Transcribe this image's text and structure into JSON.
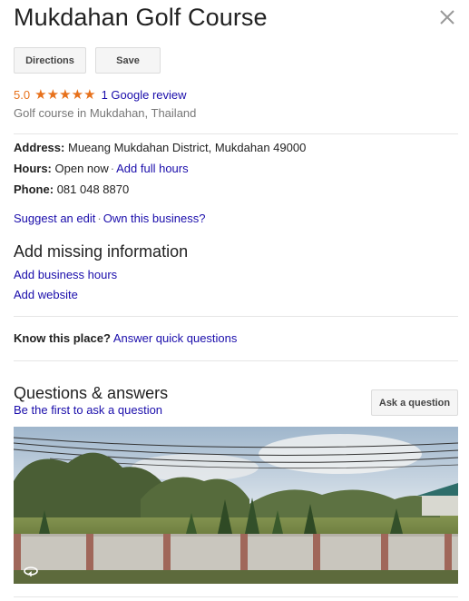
{
  "place": {
    "title": "Mukdahan Golf Course",
    "rating": "5.0",
    "stars": 5,
    "review_link": "1 Google review",
    "category": "Golf course in Mukdahan, Thailand"
  },
  "actions": {
    "directions": "Directions",
    "save": "Save"
  },
  "details": {
    "address_label": "Address:",
    "address_value": "Mueang Mukdahan District, Mukdahan 49000",
    "hours_label": "Hours:",
    "hours_value": "Open now",
    "hours_link": "Add full hours",
    "phone_label": "Phone:",
    "phone_value": "081 048 8870",
    "suggest_edit": "Suggest an edit",
    "own_business": "Own this business?"
  },
  "missing": {
    "heading": "Add missing information",
    "add_hours": "Add business hours",
    "add_website": "Add website"
  },
  "know": {
    "label": "Know this place?",
    "link": "Answer quick questions"
  },
  "qa": {
    "heading": "Questions & answers",
    "first_link": "Be the first to ask a question",
    "ask_button": "Ask a question"
  },
  "colors": {
    "star": "#e7711b",
    "link": "#1a0dab"
  },
  "icons": {
    "close": "close-icon",
    "star": "star-icon",
    "street_view": "street-view-icon"
  }
}
